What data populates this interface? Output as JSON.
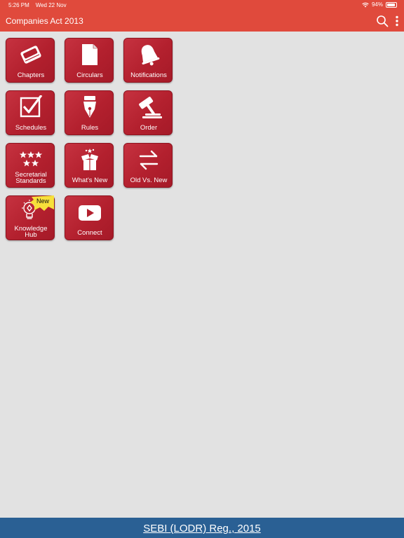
{
  "status": {
    "time": "5:26 PM",
    "date": "Wed 22 Nov",
    "battery": "94%",
    "battery_level": 0.94
  },
  "header": {
    "title": "Companies Act 2013",
    "search_icon": "search-icon",
    "more_icon": "more-vert-icon"
  },
  "tiles": [
    {
      "label": "Chapters",
      "icon": "book-icon"
    },
    {
      "label": "Circulars",
      "icon": "document-icon"
    },
    {
      "label": "Notifications",
      "icon": "bell-icon"
    },
    {
      "label": "Schedules",
      "icon": "checkbox-icon"
    },
    {
      "label": "Rules",
      "icon": "pen-nib-icon"
    },
    {
      "label": "Order",
      "icon": "gavel-icon"
    },
    {
      "label_line1": "Secretarial",
      "label_line2": "Standards",
      "icon": "stars-icon"
    },
    {
      "label": "What's New",
      "icon": "gift-box-icon"
    },
    {
      "label": "Old Vs. New",
      "icon": "swap-arrows-icon"
    },
    {
      "label_line1": "Knowledge",
      "label_line2": "Hub",
      "icon": "lightbulb-icon",
      "badge": "New"
    },
    {
      "label": "Connect",
      "icon": "play-icon"
    }
  ],
  "footer": {
    "link": "SEBI (LODR) Reg., 2015"
  },
  "colors": {
    "header": "#e04a3c",
    "tile": "#b3202e",
    "footer": "#2a6094",
    "background": "#e2e2e2",
    "badge": "#f7e03a"
  }
}
